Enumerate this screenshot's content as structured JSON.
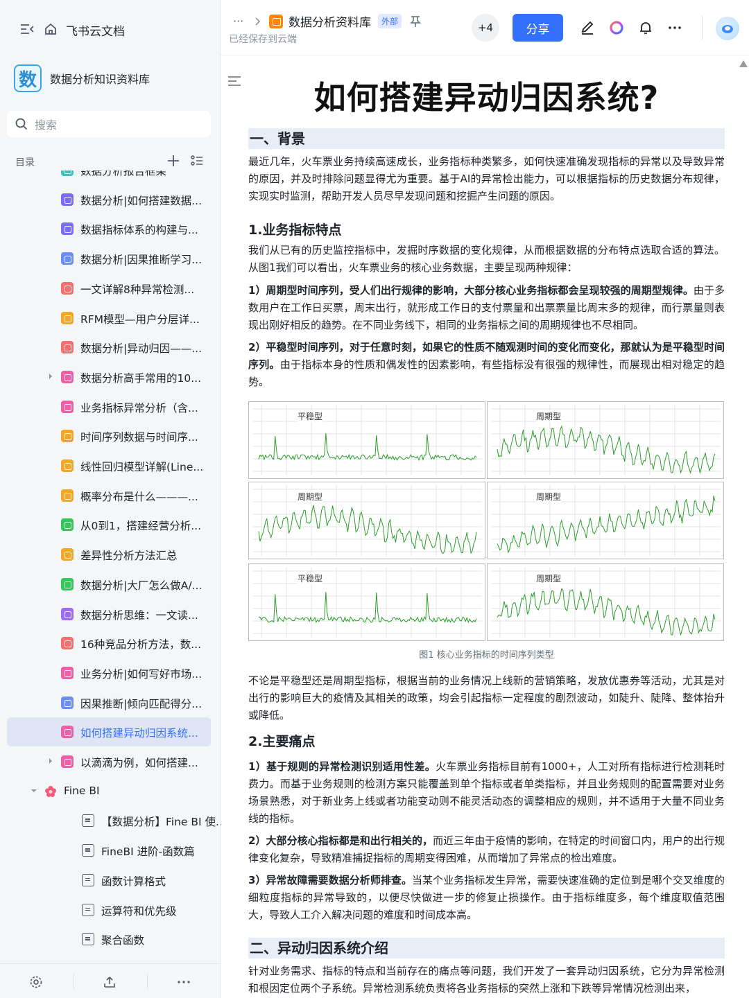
{
  "sidebar": {
    "brand": "飞书云文档",
    "space_logo_char": "数",
    "space_name": "数据分析知识资料库",
    "search_placeholder": "搜索",
    "toc_label": "目录",
    "items": [
      {
        "label": "数据分析报告框架",
        "color": "#3bc4c4"
      },
      {
        "label": "数据分析|如何搭建数据...",
        "color": "#7a6cf6"
      },
      {
        "label": "数据指标体系的构建与...",
        "color": "#7a6cf6"
      },
      {
        "label": "数据分析|因果推断学习...",
        "color": "#6b8ef6"
      },
      {
        "label": "一文详解8种异常检测...",
        "color": "#f76e6e"
      },
      {
        "label": "RFM模型—用户分层详...",
        "color": "#f5a623"
      },
      {
        "label": "数据分析|异动归因——...",
        "color": "#f76e6e"
      },
      {
        "label": "数据分析高手常用的10...",
        "color": "#ee5fa8",
        "caret": true
      },
      {
        "label": "业务指标异常分析（含...",
        "color": "#ee5fa8"
      },
      {
        "label": "时间序列数据与时间序...",
        "color": "#f5a623"
      },
      {
        "label": "线性回归模型详解(Line...",
        "color": "#f5a623"
      },
      {
        "label": "概率分布是什么———...",
        "color": "#f5a623"
      },
      {
        "label": "从0到1，搭建经营分析...",
        "color": "#34c759"
      },
      {
        "label": "差异性分析方法汇总",
        "color": "#f5a623"
      },
      {
        "label": "数据分析|大厂怎么做A/...",
        "color": "#34c759"
      },
      {
        "label": "数据分析思维：一文读...",
        "color": "#9b6cf6"
      },
      {
        "label": "16种竞品分析方法，数...",
        "color": "#f76e6e"
      },
      {
        "label": "业务分析|如何写好市场...",
        "color": "#ee5fa8"
      },
      {
        "label": "因果推断|倾向匹配得分...",
        "color": "#6b8ef6"
      },
      {
        "label": "如何搭建异动归因系统...",
        "color": "#ee5fa8",
        "active": true
      },
      {
        "label": "以滴滴为例，如何搭建...",
        "color": "#ee5fa8",
        "caret": true
      }
    ],
    "group": {
      "label": "Fine BI"
    },
    "docs": [
      {
        "label": "【数据分析】Fine BI 使..."
      },
      {
        "label": "FineBI 进阶-函数篇"
      },
      {
        "label": "函数计算格式"
      },
      {
        "label": "运算符和优先级"
      },
      {
        "label": "聚合函数"
      }
    ]
  },
  "header": {
    "more": "···",
    "doc_title": "数据分析资料库",
    "tag": "外部",
    "saved": "已经保存到云端",
    "collaborators": "+4",
    "share": "分享"
  },
  "doc": {
    "title": "如何搭建异动归因系统?",
    "h2_1": "一、背景",
    "p1": "最近几年，火车票业务持续高速成长，业务指标种类繁多，如何快速准确发现指标的异常以及导致异常的原因，并及时排除问题显得尤为重要。基于AI的异常检出能力，可以根据指标的历史数据分布规律，实现实时监测，帮助开发人员尽早发现问题和挖掘产生问题的原因。",
    "h3_1": "1.业务指标特点",
    "p2": "我们从已有的历史监控指标中，发掘时序数据的变化规律，从而根据数据的分布特点选取合适的算法。从图1我们可以看出，火车票业务的核心业务数据，主要呈现两种规律：",
    "p3_bold": "1）周期型时间序列，受人们出行规律的影响，大部分核心业务指标都会呈现较强的周期型规律。",
    "p3_rest": "由于多数用户在工作日买票，周末出行，就形成工作日的支付票量和出票票量比周末多的规律，而行票量则表现出刚好相反的趋势。在不同业务线下，相同的业务指标之间的周期规律也不尽相同。",
    "p4_bold": "2）平稳型时间序列，对于任意时刻，如果它的性质不随观测时间的变化而变化，那就认为是平稳型时间序列。",
    "p4_rest": "由于指标本身的性质和偶发性的因素影响，有些指标没有很强的规律性，而展现出相对稳定的趋势。",
    "figure_caption": "图1 核心业务指标的时间序列类型",
    "panels": [
      "平稳型",
      "周期型",
      "周期型",
      "周期型",
      "平稳型",
      "周期型"
    ],
    "p5": "不论是平稳型还是周期型指标，根据当前的业务情况上线新的营销策略，发放优惠券等活动，尤其是对出行的影响巨大的疫情及其相关的政策，均会引起指标一定程度的剧烈波动，如陡升、陡降、整体抬升或降低。",
    "h3_2": "2.主要痛点",
    "p6_bold": "1）基于规则的异常检测识别适用性差。",
    "p6_rest": "火车票业务指标目前有1000+，人工对所有指标进行检测耗时费力。而基于业务规则的检测方案只能覆盖到单个指标或者单类指标，并且业务规则的配置需要对业务场景熟悉，对于新业务上线或者功能变动则不能灵活动态的调整相应的规则，并不适用于大量不同业务线的指标。",
    "p7_bold": "2）大部分核心指标都是和出行相关的，",
    "p7_rest": "而近三年由于疫情的影响，在特定的时间窗口内，用户的出行规律变化复杂，导致精准捕捉指标的周期变得困难，从而增加了异常点的检出难度。",
    "p8_bold": "3）异常故障需要数据分析师排查。",
    "p8_rest": "当某个业务指标发生异常，需要快速准确的定位到是哪个交叉维度的细粒度指标的异常导致的，以便尽快做进一步的修复止损操作。由于指标维度多，每个维度取值范围大，导致人工介入解决问题的难度和时间成本高。",
    "h2_2": "二、异动归因系统介绍",
    "p9": "针对业务需求、指标的特点和当前存在的痛点等问题，我们开发了一套异动归因系统，它分为异常检测和根因定位两个子系统。异常检测系统负责将各业务指标的突然上涨和下跌等异常情况检测出来，"
  },
  "colors": {
    "accent": "#3370ff",
    "line": "#2a9d2a",
    "heading_bg": "#e8eef8"
  }
}
